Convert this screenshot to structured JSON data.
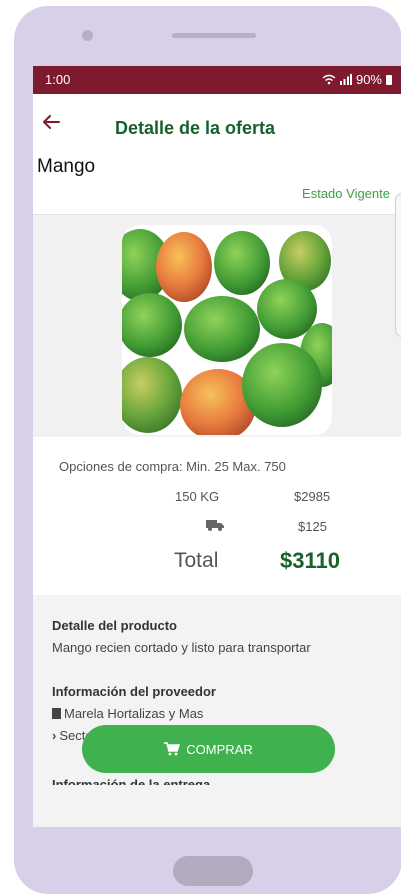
{
  "status_bar": {
    "time": "1:00",
    "battery": "90%"
  },
  "appbar": {
    "title": "Detalle de la oferta"
  },
  "product": {
    "name": "Mango",
    "status": "Estado Vigente"
  },
  "purchase": {
    "options_text": "Opciones de compra: Min. 25  Max. 750",
    "quantity": "150 KG",
    "quantity_price": "$2985",
    "shipping_price": "$125",
    "total_label": "Total",
    "total_value": "$3110"
  },
  "details": {
    "product_heading": "Detalle del producto",
    "product_desc": "Mango recien cortado y listo para transportar",
    "provider_heading": "Información del proveedor",
    "provider_name": "Marela Hortalizas y Mas",
    "provider_sector": "Sector Agroindustrial",
    "delivery_heading": "Información de la entrega"
  },
  "buy_button": {
    "label": "COMPRAR"
  },
  "icons": {
    "back": "arrow-left-icon",
    "truck": "truck-icon",
    "cart": "cart-icon",
    "building": "building-icon",
    "chevron": "chevron-right-icon"
  },
  "colors": {
    "statusbar": "#7d1a2d",
    "title": "#17622a",
    "accent": "#3fb24f"
  }
}
